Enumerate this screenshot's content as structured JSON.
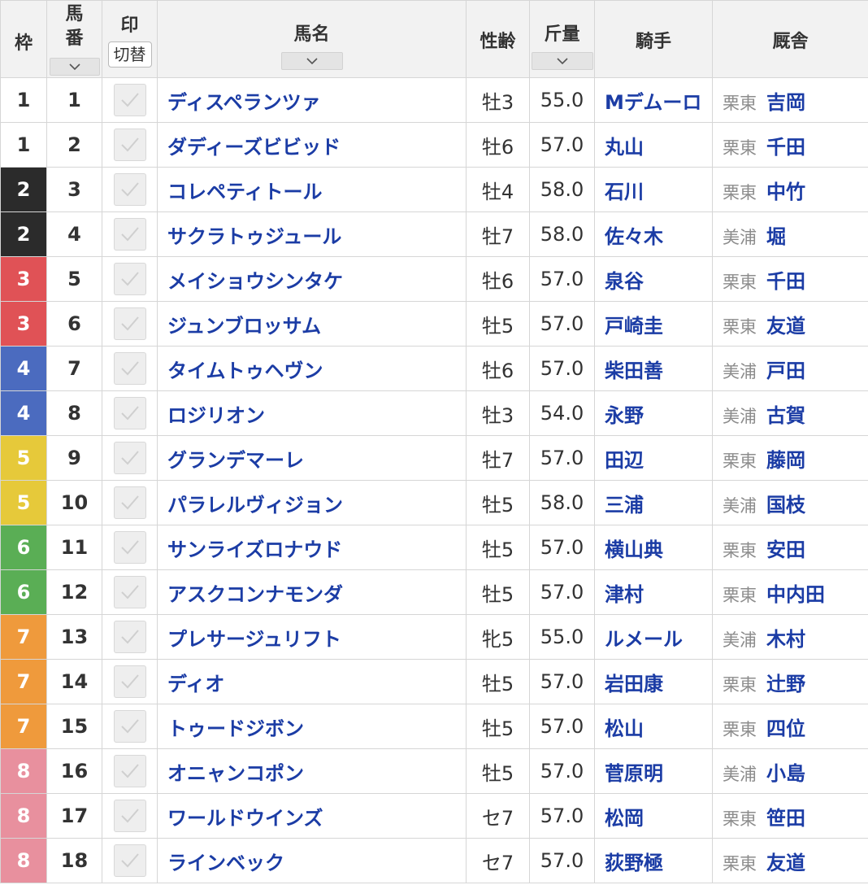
{
  "header": {
    "waku": "枠",
    "umaban_top": "馬",
    "umaban_bottom": "番",
    "mark": "印",
    "switch_label": "切替",
    "horse_name": "馬名",
    "sex_age": "性齢",
    "weight": "斤量",
    "jockey": "騎手",
    "stable": "厩舎"
  },
  "colors": {
    "1": "#ffffff",
    "2": "#2b2b2b",
    "3": "#e05256",
    "4": "#4b6bbf",
    "5": "#e6c93a",
    "6": "#5aae55",
    "7": "#ef9a3c",
    "8": "#e8909e",
    "link": "#1b3ca5"
  },
  "rows": [
    {
      "waku": "1",
      "umaban": "1",
      "name": "ディスペランツァ",
      "sex_age": "牡3",
      "weight": "55.0",
      "jockey": "Mデムーロ",
      "region": "栗東",
      "trainer": "吉岡"
    },
    {
      "waku": "1",
      "umaban": "2",
      "name": "ダディーズビビッド",
      "sex_age": "牡6",
      "weight": "57.0",
      "jockey": "丸山",
      "region": "栗東",
      "trainer": "千田"
    },
    {
      "waku": "2",
      "umaban": "3",
      "name": "コレペティトール",
      "sex_age": "牡4",
      "weight": "58.0",
      "jockey": "石川",
      "region": "栗東",
      "trainer": "中竹"
    },
    {
      "waku": "2",
      "umaban": "4",
      "name": "サクラトゥジュール",
      "sex_age": "牡7",
      "weight": "58.0",
      "jockey": "佐々木",
      "region": "美浦",
      "trainer": "堀"
    },
    {
      "waku": "3",
      "umaban": "5",
      "name": "メイショウシンタケ",
      "sex_age": "牡6",
      "weight": "57.0",
      "jockey": "泉谷",
      "region": "栗東",
      "trainer": "千田"
    },
    {
      "waku": "3",
      "umaban": "6",
      "name": "ジュンブロッサム",
      "sex_age": "牡5",
      "weight": "57.0",
      "jockey": "戸崎圭",
      "region": "栗東",
      "trainer": "友道"
    },
    {
      "waku": "4",
      "umaban": "7",
      "name": "タイムトゥヘヴン",
      "sex_age": "牡6",
      "weight": "57.0",
      "jockey": "柴田善",
      "region": "美浦",
      "trainer": "戸田"
    },
    {
      "waku": "4",
      "umaban": "8",
      "name": "ロジリオン",
      "sex_age": "牡3",
      "weight": "54.0",
      "jockey": "永野",
      "region": "美浦",
      "trainer": "古賀"
    },
    {
      "waku": "5",
      "umaban": "9",
      "name": "グランデマーレ",
      "sex_age": "牡7",
      "weight": "57.0",
      "jockey": "田辺",
      "region": "栗東",
      "trainer": "藤岡"
    },
    {
      "waku": "5",
      "umaban": "10",
      "name": "パラレルヴィジョン",
      "sex_age": "牡5",
      "weight": "58.0",
      "jockey": "三浦",
      "region": "美浦",
      "trainer": "国枝"
    },
    {
      "waku": "6",
      "umaban": "11",
      "name": "サンライズロナウド",
      "sex_age": "牡5",
      "weight": "57.0",
      "jockey": "横山典",
      "region": "栗東",
      "trainer": "安田"
    },
    {
      "waku": "6",
      "umaban": "12",
      "name": "アスクコンナモンダ",
      "sex_age": "牡5",
      "weight": "57.0",
      "jockey": "津村",
      "region": "栗東",
      "trainer": "中内田"
    },
    {
      "waku": "7",
      "umaban": "13",
      "name": "プレサージュリフト",
      "sex_age": "牝5",
      "weight": "55.0",
      "jockey": "ルメール",
      "region": "美浦",
      "trainer": "木村"
    },
    {
      "waku": "7",
      "umaban": "14",
      "name": "ディオ",
      "sex_age": "牡5",
      "weight": "57.0",
      "jockey": "岩田康",
      "region": "栗東",
      "trainer": "辻野"
    },
    {
      "waku": "7",
      "umaban": "15",
      "name": "トゥードジボン",
      "sex_age": "牡5",
      "weight": "57.0",
      "jockey": "松山",
      "region": "栗東",
      "trainer": "四位"
    },
    {
      "waku": "8",
      "umaban": "16",
      "name": "オニャンコポン",
      "sex_age": "牡5",
      "weight": "57.0",
      "jockey": "菅原明",
      "region": "美浦",
      "trainer": "小島"
    },
    {
      "waku": "8",
      "umaban": "17",
      "name": "ワールドウインズ",
      "sex_age": "セ7",
      "weight": "57.0",
      "jockey": "松岡",
      "region": "栗東",
      "trainer": "笹田"
    },
    {
      "waku": "8",
      "umaban": "18",
      "name": "ラインベック",
      "sex_age": "セ7",
      "weight": "57.0",
      "jockey": "荻野極",
      "region": "栗東",
      "trainer": "友道"
    }
  ]
}
